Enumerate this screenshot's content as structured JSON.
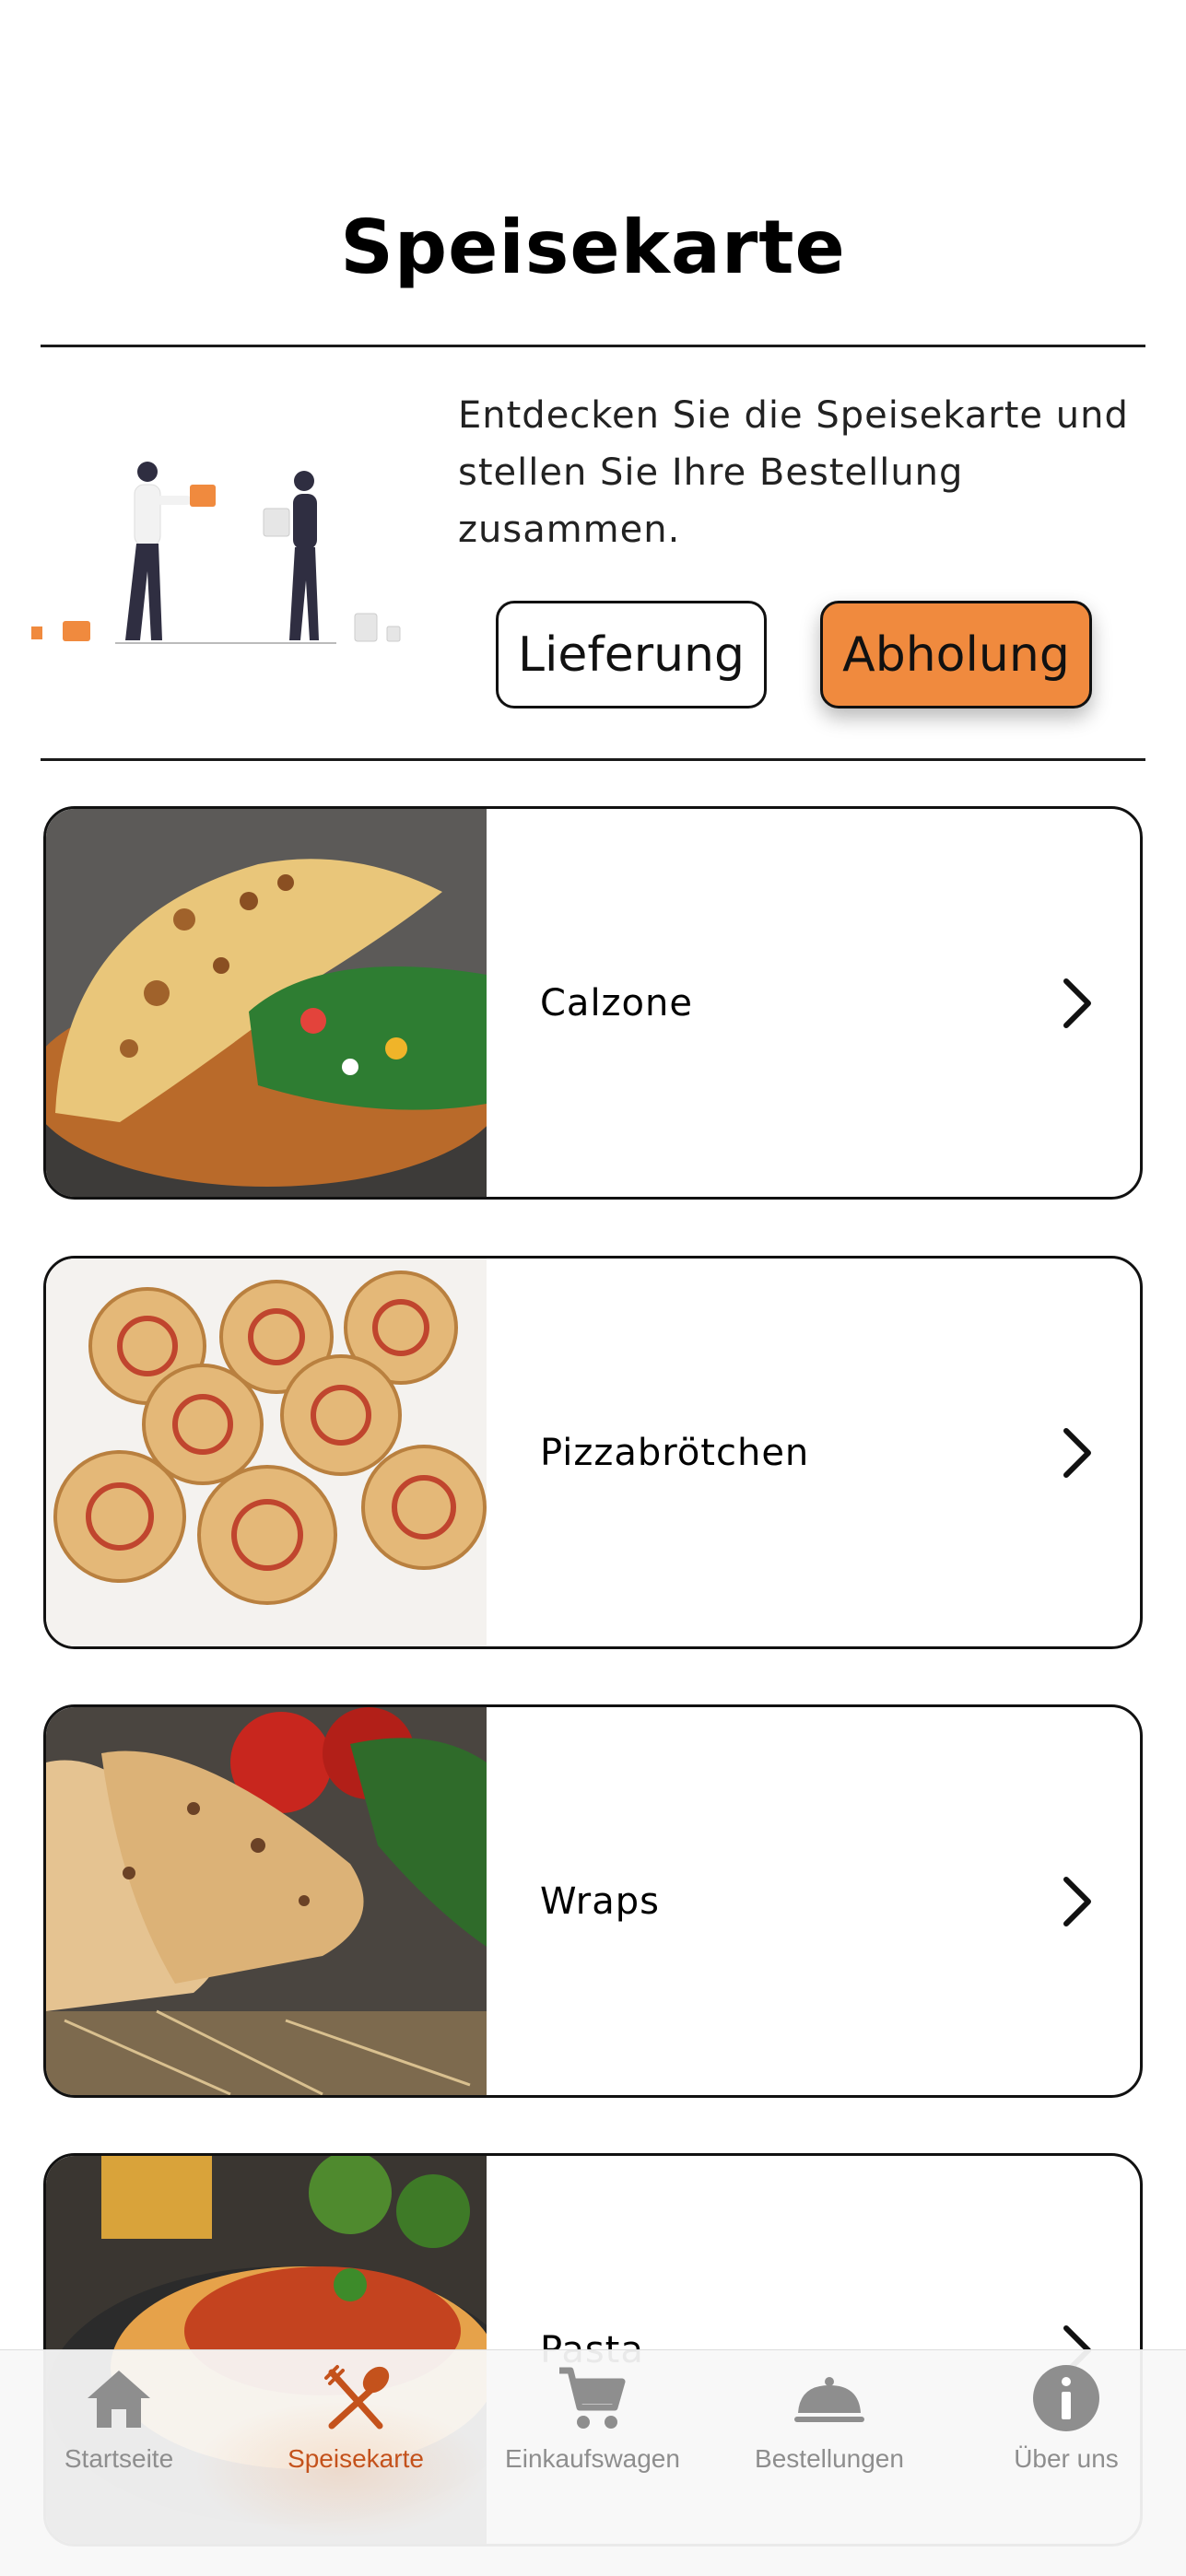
{
  "header": {
    "title": "Speisekarte"
  },
  "intro": {
    "text": "Entdecken Sie die Speisekarte und stellen Sie Ihre Bestellung zusammen.",
    "delivery_label": "Lieferung",
    "pickup_label": "Abholung",
    "selected_mode": "Abholung"
  },
  "categories": [
    {
      "label": "Calzone"
    },
    {
      "label": "Pizzabrötchen"
    },
    {
      "label": "Wraps"
    },
    {
      "label": "Pasta"
    }
  ],
  "tabbar": {
    "active": "Speisekarte",
    "tabs": [
      {
        "label": "Startseite",
        "icon": "home-icon"
      },
      {
        "label": "Speisekarte",
        "icon": "cutlery-icon"
      },
      {
        "label": "Einkaufswagen",
        "icon": "cart-icon"
      },
      {
        "label": "Bestellungen",
        "icon": "cloche-icon"
      },
      {
        "label": "Über uns",
        "icon": "info-icon"
      }
    ]
  },
  "colors": {
    "accent": "#f08a3e",
    "active_tab": "#c4521c",
    "inactive_tab": "#8e8e8e"
  }
}
